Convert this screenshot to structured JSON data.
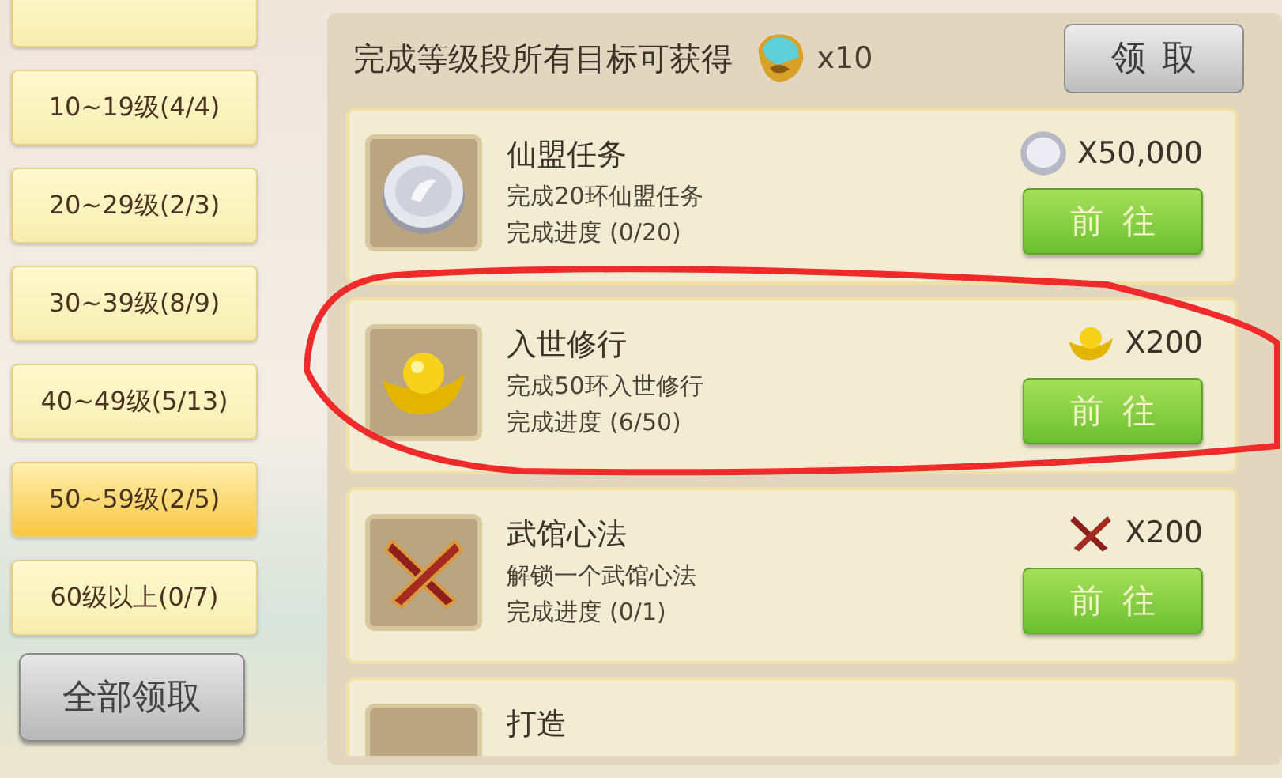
{
  "level_tabs": [
    {
      "selected": false
    },
    {
      "label": "10~19级(4/4)",
      "selected": false
    },
    {
      "label": "20~29级(2/3)",
      "selected": false
    },
    {
      "label": "30~39级(8/9)",
      "selected": false
    },
    {
      "label": "40~49级(5/13)",
      "selected": false
    },
    {
      "label": "50~59级(2/5)",
      "selected": true
    },
    {
      "label": "60级以上(0/7)",
      "selected": false
    }
  ],
  "claim_all_button": "全部领取",
  "header": {
    "title": "完成等级段所有目标可获得",
    "reward_count": "x10",
    "claim_button": "领取"
  },
  "tasks": [
    {
      "kind": "coin",
      "title": "仙盟任务",
      "description": "完成20环仙盟任务",
      "progress": "完成进度 (0/20)",
      "reward": "X50,000",
      "button": "前往"
    },
    {
      "kind": "ingot",
      "title": "入世修行",
      "description": "完成50环入世修行",
      "progress": "完成进度 (6/50)",
      "reward": "X200",
      "button": "前往"
    },
    {
      "kind": "swords",
      "title": "武馆心法",
      "description": "解锁一个武馆心法",
      "progress": "完成进度 (0/1)",
      "reward": "X200",
      "button": "前往"
    },
    {
      "kind": "blank",
      "title": "打造"
    }
  ]
}
